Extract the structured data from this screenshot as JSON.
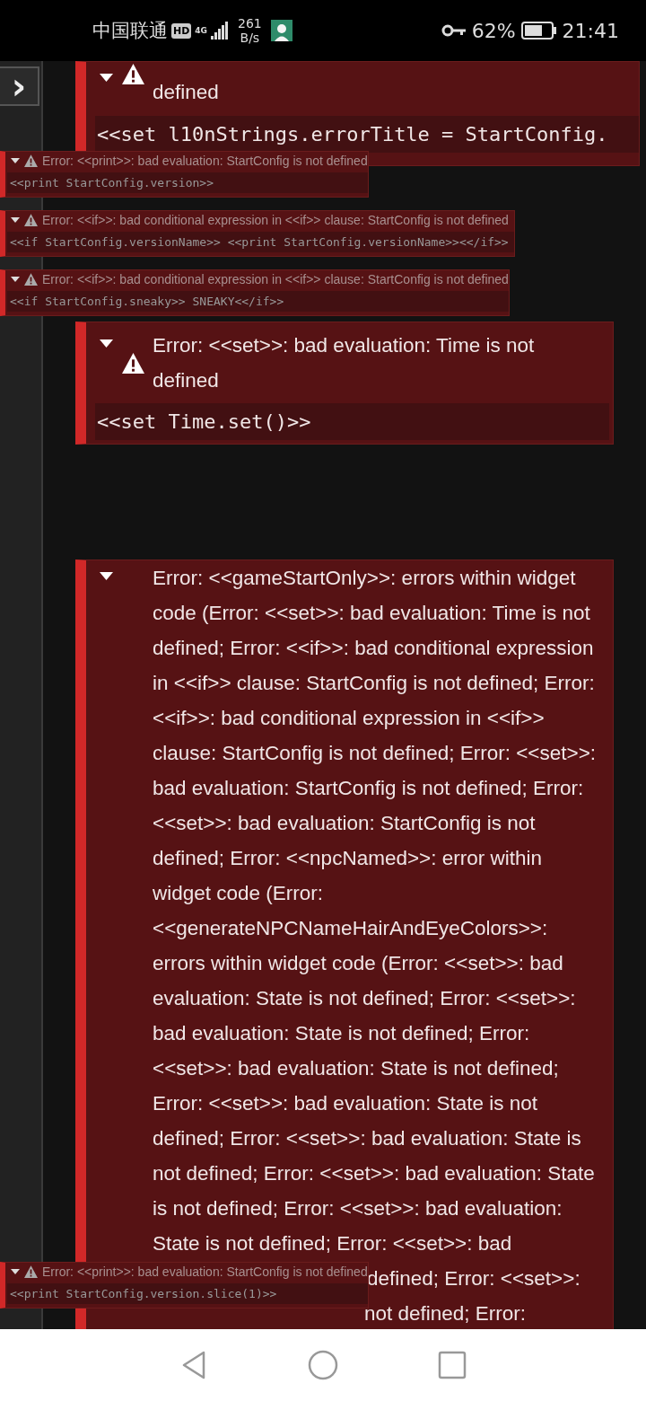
{
  "status_bar": {
    "carrier": "中国联通",
    "hd": "HD",
    "network": "4G",
    "speed_value": "261",
    "speed_unit": "B/s",
    "battery_percent": "62%",
    "time": "21:41"
  },
  "sidebar": {
    "toggle": "›"
  },
  "errors": [
    {
      "title": "defined",
      "code": "<<set l10nStrings.errorTitle = StartConfig.",
      "warning_icon": true,
      "expanded": true
    },
    {
      "title": "Error: <<set>>: bad evaluation: Time is not defined",
      "code": "<<set Time.set()>>",
      "warning_icon": true,
      "expanded": true
    },
    {
      "title": "Error: <<gameStartOnly>>: errors within widget code (Error: <<set>>: bad evaluation: Time is not defined; Error: <<if>>: bad conditional expression in <<if>> clause: StartConfig is not defined; Error: <<if>>: bad conditional expression in <<if>> clause: StartConfig is not defined; Error: <<set>>: bad evaluation: StartConfig is not defined; Error: <<set>>: bad evaluation: StartConfig is not defined; Error: <<npcNamed>>: error within widget code (Error: <<generateNPCNameHairAndEyeColors>>: errors within widget code (Error: <<set>>: bad evaluation: State is not defined; Error: <<set>>: bad evaluation: State is not defined; Error: <<set>>: bad evaluation: State is not defined; Error: <<set>>: bad evaluation: State is not defined; Error: <<set>>: bad evaluation: State is not defined; Error: <<set>>: bad evaluation: State is not defined; Error: <<set>>: bad evaluation: State is not defined; Error: <<set>>: bad",
      "tail_lines": [
        "defined; Error: <<set>>:",
        "not defined; Error:"
      ],
      "warning_icon": false,
      "expanded": true
    }
  ],
  "small_errors": [
    {
      "title": "Error: <<print>>: bad evaluation: StartConfig is not defined",
      "code": "<<print StartConfig.version>>",
      "expanded": true
    },
    {
      "title": "Error: <<if>>: bad conditional expression in <<if>> clause: StartConfig is not defined",
      "code": "<<if StartConfig.versionName>> <<print StartConfig.versionName>><</if>>",
      "expanded": true
    },
    {
      "title": "Error: <<if>>: bad conditional expression in <<if>> clause: StartConfig is not defined",
      "code": "<<if StartConfig.sneaky>> SNEAKY<</if>>",
      "expanded": true
    },
    {
      "title": "Error: <<print>>: bad evaluation: StartConfig is not defined",
      "code": "<<print StartConfig.version.slice(1)>>",
      "expanded": true
    }
  ]
}
